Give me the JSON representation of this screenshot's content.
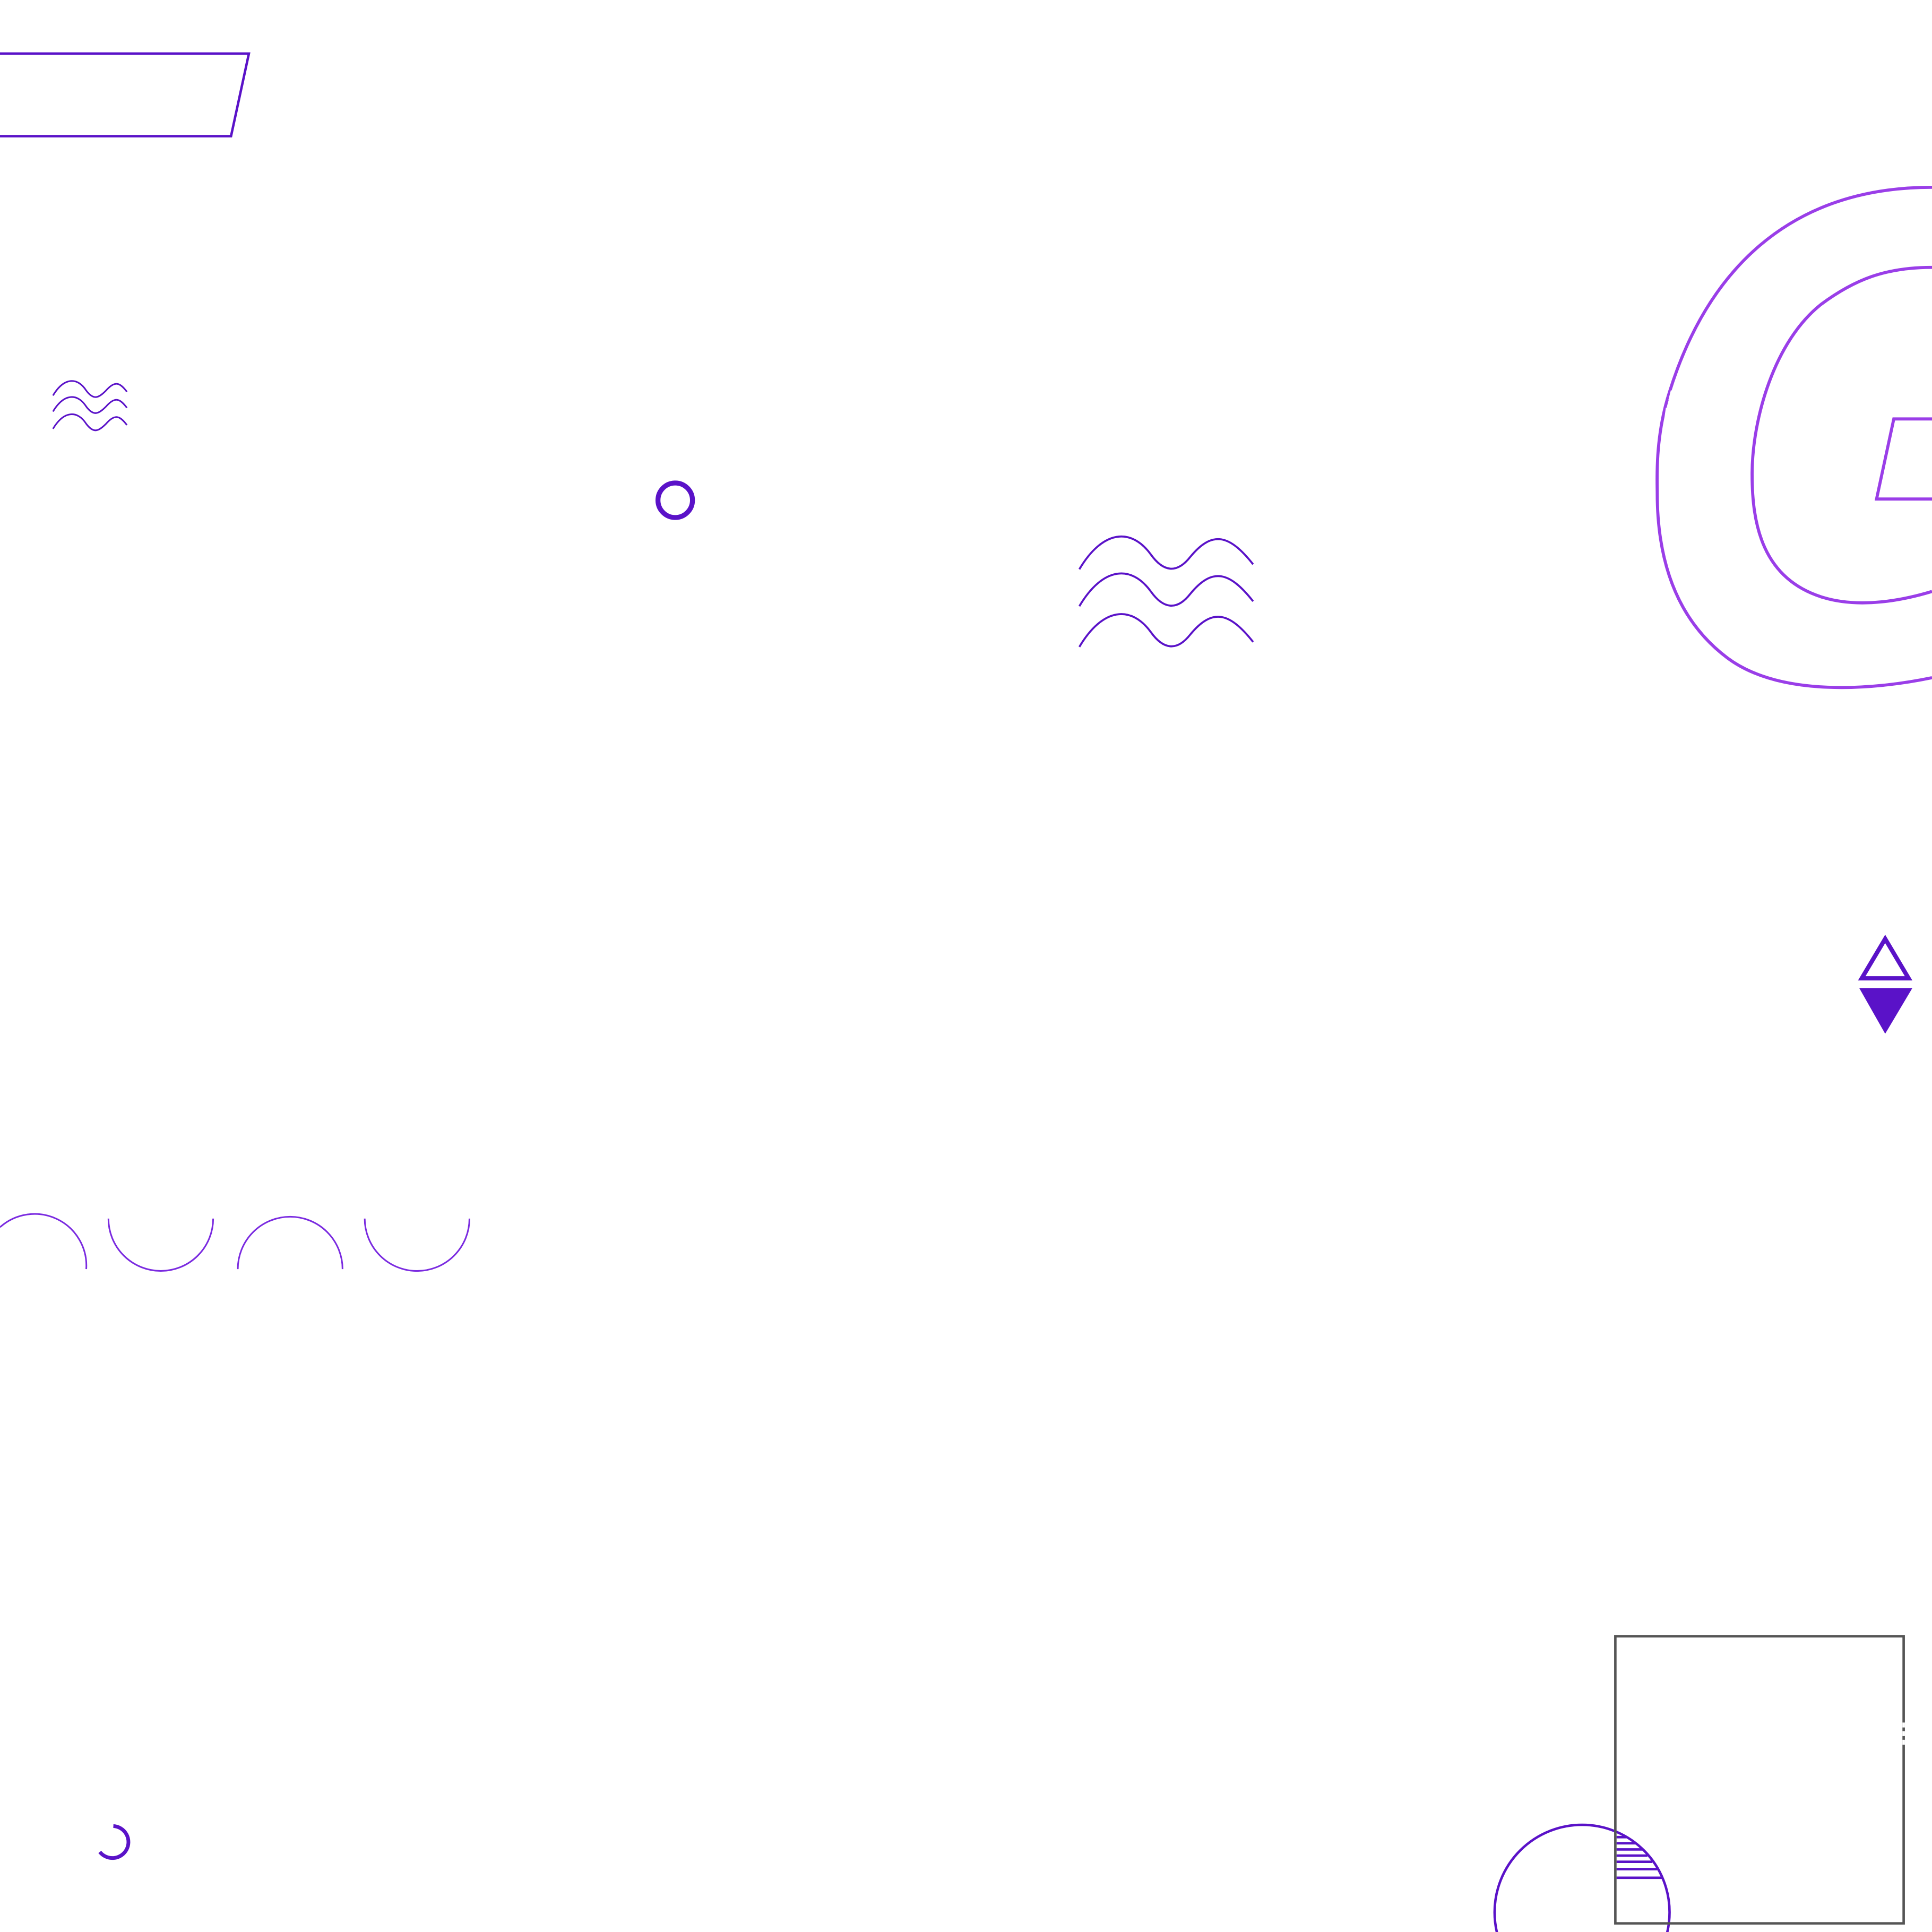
{
  "palette": {
    "primary_purple": "#5a12c8",
    "light_purple": "#9a3ee8",
    "frame_gray": "#555555",
    "background": "#ffffff"
  },
  "decorations": [
    "parallelogram-outline",
    "wave-lines-small",
    "ring",
    "wave-lines-large",
    "concentric-c-outline",
    "triangle-pair",
    "semicircle-chain",
    "open-circle-arc",
    "square-frame",
    "striped-circle"
  ]
}
